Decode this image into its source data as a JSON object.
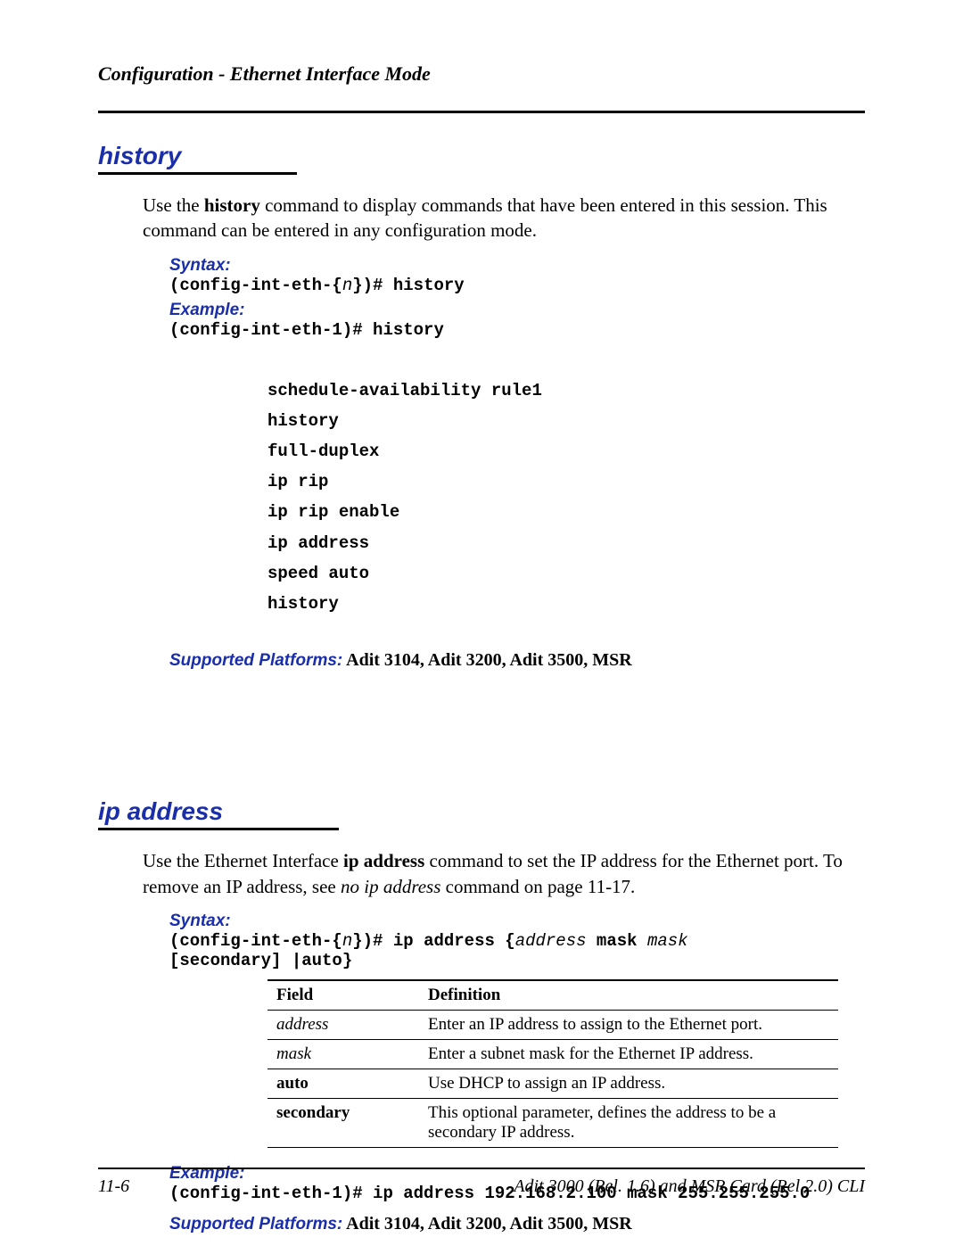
{
  "header": "Configuration - Ethernet Interface Mode",
  "history": {
    "title": "history",
    "intro_1": "Use the ",
    "intro_cmd": "history",
    "intro_2": " command to display commands that have been entered in this session.  This command can be entered in any configuration mode.",
    "syntax_label": "Syntax:",
    "syntax_a": "(config-int-eth-{",
    "syntax_n": "n",
    "syntax_b": "})# history",
    "example_label": "Example:",
    "example_cmd": "(config-int-eth-1)# history",
    "output": [
      "schedule-availability rule1",
      "history",
      "full-duplex",
      "ip rip",
      "ip rip enable",
      "ip address",
      "speed auto",
      "history"
    ],
    "platforms_label": "Supported Platforms:",
    "platforms_value": "  Adit 3104, Adit 3200, Adit 3500, MSR"
  },
  "ipaddress": {
    "title": "ip address",
    "intro_1": "Use the Ethernet Interface ",
    "intro_cmd": "ip address",
    "intro_2": " command to set the IP address for the Ethernet port. To remove an IP address, see ",
    "intro_ref": "no ip address",
    "intro_3": " command on page 11-17.",
    "syntax_label": "Syntax:",
    "syntax_a": "(config-int-eth-{",
    "syntax_n": "n",
    "syntax_b": "})# ip address {",
    "syntax_addr": "address",
    "syntax_c": " mask ",
    "syntax_mask": "mask",
    "syntax_d": " [secondary] |auto}",
    "th_field": "Field",
    "th_def": "Definition",
    "rows": [
      {
        "field": "address",
        "italic": true,
        "def": "Enter an IP address to assign to the Ethernet port."
      },
      {
        "field": "mask",
        "italic": true,
        "def": "Enter a subnet mask for the Ethernet IP address."
      },
      {
        "field": "auto",
        "bold": true,
        "def": "Use DHCP to assign an IP address."
      },
      {
        "field": "secondary",
        "bold": true,
        "def": "This optional parameter, defines the address to be a secondary IP address."
      }
    ],
    "example_label": "Example:",
    "example_cmd": "(config-int-eth-1)# ip address 192.168.2.100 mask 255.255.255.0",
    "platforms_label": "Supported Platforms:",
    "platforms_value": "  Adit 3104, Adit 3200, Adit 3500, MSR"
  },
  "footer": {
    "left": "11-6",
    "right": "Adit 3000 (Rel. 1.6) and MSR Card (Rel 2.0) CLI"
  }
}
